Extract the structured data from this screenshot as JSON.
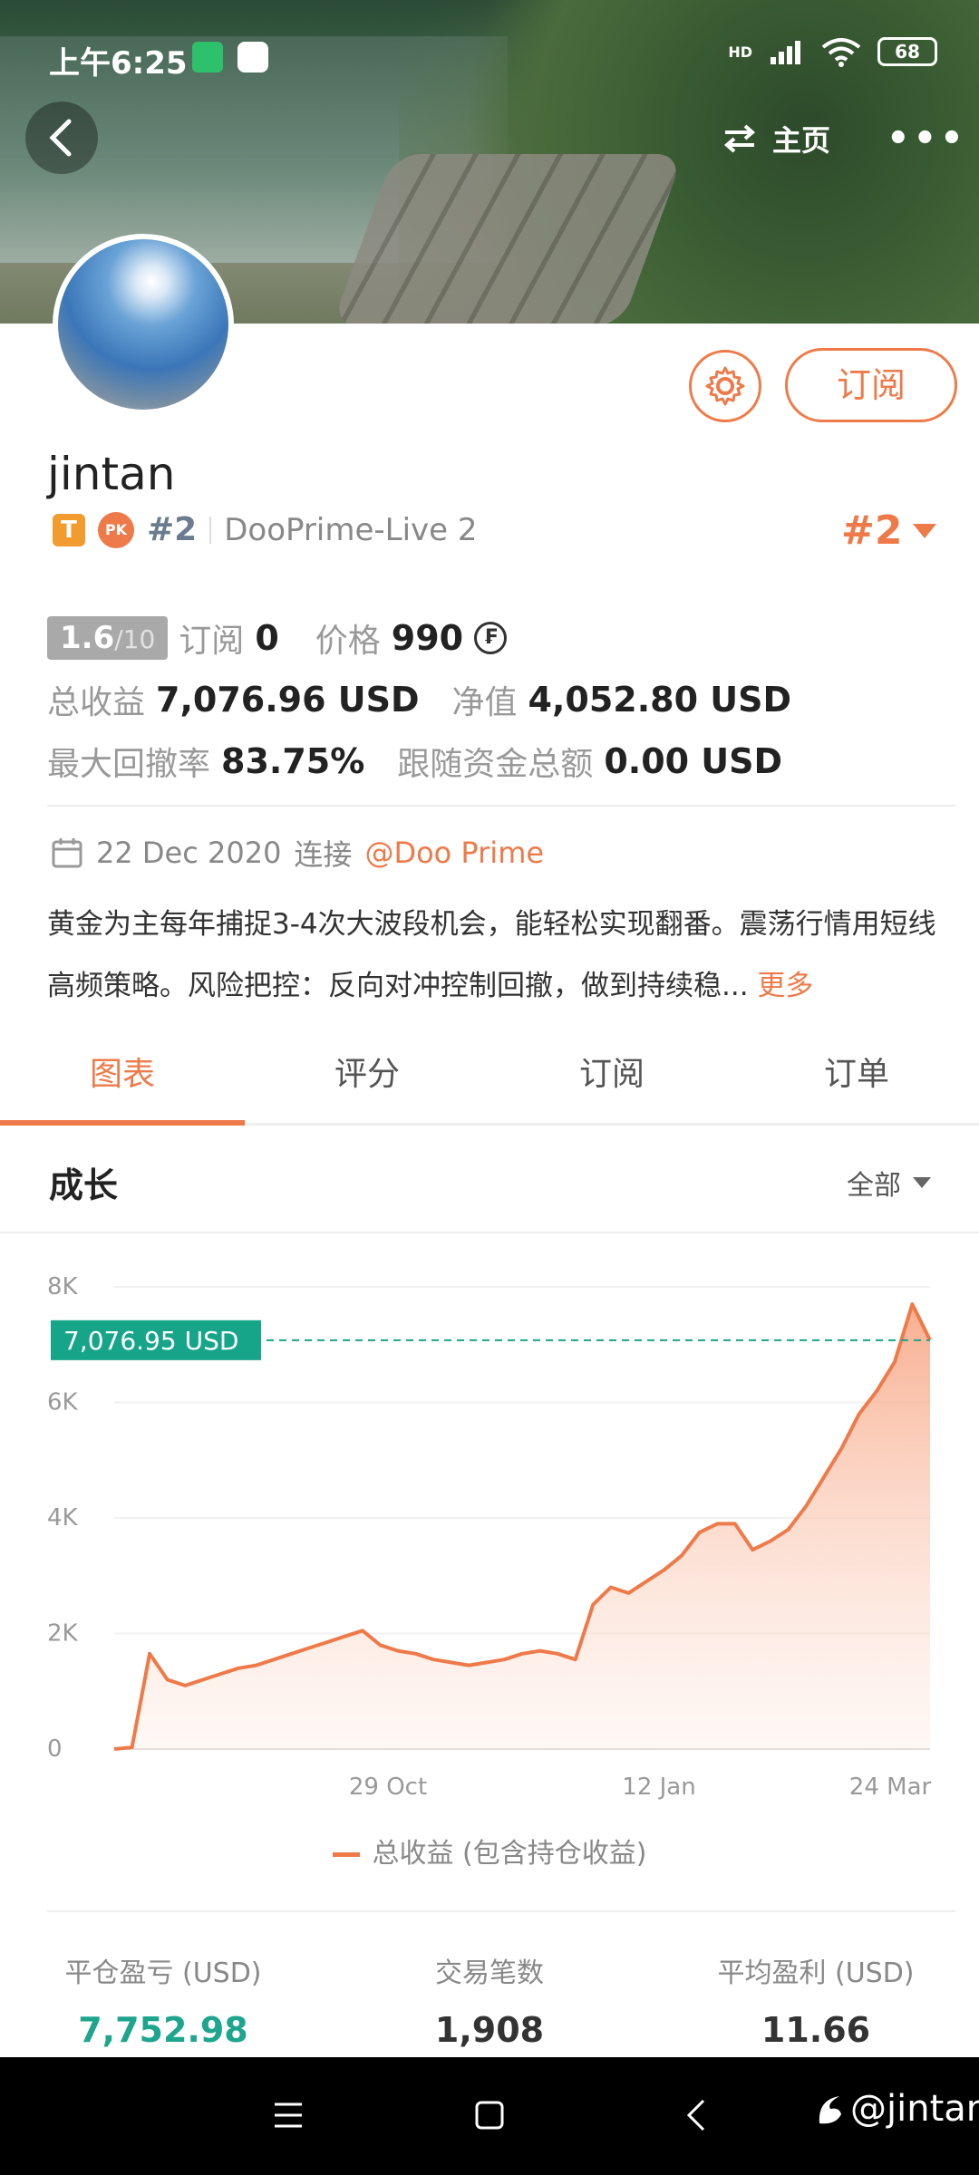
{
  "status_bar": {
    "time": "上午6:25",
    "battery": "68",
    "signal": "HD"
  },
  "header": {
    "home_label": "主页",
    "more_label": "•••"
  },
  "profile": {
    "username": "jintan",
    "subscribe_label": "订阅",
    "t_badge": "T",
    "pk_badge": "PK",
    "rank_small": "#2",
    "server": "DooPrime-Live 2",
    "rank_big": "#2"
  },
  "stats": {
    "score": "1.6",
    "score_den": "/10",
    "subscriptions_label": "订阅",
    "subscriptions_value": "0",
    "price_label": "价格",
    "price_value": "990",
    "coin_symbol": "₣",
    "total_profit_label": "总收益",
    "total_profit_value": "7,076.96 USD",
    "equity_label": "净值",
    "equity_value": "4,052.80 USD",
    "max_drawdown_label": "最大回撤率",
    "max_drawdown_value": "83.75%",
    "follow_funds_label": "跟随资金总额",
    "follow_funds_value": "0.00 USD"
  },
  "connect": {
    "date": "22 Dec 2020",
    "connect_label": "连接",
    "broker": "@Doo Prime"
  },
  "bio": {
    "text": "黄金为主每年捕捉3-4次大波段机会，能轻松实现翻番。震荡行情用短线高频策略。风险把控：反向对冲控制回撤，做到持续稳...",
    "more_label": "更多"
  },
  "tabs": [
    {
      "label": "图表"
    },
    {
      "label": "评分"
    },
    {
      "label": "订阅"
    },
    {
      "label": "订单"
    }
  ],
  "section": {
    "title": "成长",
    "filter_label": "全部"
  },
  "chart_data": {
    "type": "area",
    "title": "",
    "ylabel": "",
    "ylim": [
      0,
      8000
    ],
    "y_ticks": [
      "0",
      "2K",
      "4K",
      "6K",
      "8K"
    ],
    "x_tick_labels": [
      "29 Oct",
      "12 Jan",
      "24 Mar"
    ],
    "current_value_label": "7,076.95 USD",
    "current_value": 7076.95,
    "series": [
      {
        "name": "总收益 (包含持仓收益)",
        "values": [
          0,
          30,
          1650,
          1200,
          1100,
          1200,
          1300,
          1400,
          1450,
          1550,
          1650,
          1750,
          1850,
          1950,
          2050,
          1800,
          1700,
          1650,
          1550,
          1500,
          1450,
          1500,
          1550,
          1650,
          1700,
          1650,
          1550,
          2500,
          2800,
          2700,
          2900,
          3100,
          3350,
          3750,
          3900,
          3900,
          3450,
          3600,
          3800,
          4200,
          4700,
          5200,
          5800,
          6200,
          6700,
          7700,
          7076.95
        ]
      }
    ]
  },
  "legend_label": "总收益 (包含持仓收益)",
  "summary": [
    {
      "label": "平仓盈亏 (USD)",
      "value": "7,752.98"
    },
    {
      "label": "交易笔数",
      "value": "1,908"
    },
    {
      "label": "平均盈利 (USD)",
      "value": "11.66"
    }
  ],
  "watermark": "@jintan",
  "colors": {
    "accent": "#ef7a49",
    "green": "#1ea58e",
    "marker": "#17a589"
  }
}
